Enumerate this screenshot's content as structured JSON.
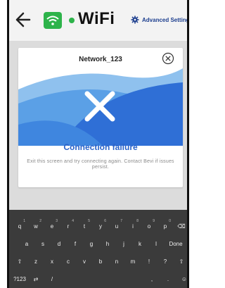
{
  "header": {
    "title": "WiFi",
    "advanced_settings_label": "Advanced Settings"
  },
  "modal": {
    "title": "Network_123",
    "heading": "Connection failure",
    "message": "Exit this screen and try connecting again. Contact Bevi if issues persist."
  },
  "keyboard": {
    "row1": [
      {
        "label": "q",
        "sub": "1"
      },
      {
        "label": "w",
        "sub": "2"
      },
      {
        "label": "e",
        "sub": "3"
      },
      {
        "label": "r",
        "sub": "4"
      },
      {
        "label": "t",
        "sub": "5"
      },
      {
        "label": "y",
        "sub": "6"
      },
      {
        "label": "u",
        "sub": "7"
      },
      {
        "label": "i",
        "sub": "8"
      },
      {
        "label": "o",
        "sub": "9"
      },
      {
        "label": "p",
        "sub": "0"
      },
      {
        "label": "⌫",
        "sub": ""
      }
    ],
    "row2": [
      {
        "label": "a"
      },
      {
        "label": "s"
      },
      {
        "label": "d"
      },
      {
        "label": "f"
      },
      {
        "label": "g"
      },
      {
        "label": "h"
      },
      {
        "label": "j"
      },
      {
        "label": "k"
      },
      {
        "label": "l"
      },
      {
        "label": "Done"
      }
    ],
    "row3": [
      {
        "label": "⇧"
      },
      {
        "label": "z"
      },
      {
        "label": "x"
      },
      {
        "label": "c"
      },
      {
        "label": "v"
      },
      {
        "label": "b"
      },
      {
        "label": "n"
      },
      {
        "label": "m"
      },
      {
        "label": "!"
      },
      {
        "label": "?"
      },
      {
        "label": "⇧"
      }
    ],
    "row4": [
      {
        "label": "?123"
      },
      {
        "label": "⇄"
      },
      {
        "label": "/"
      },
      {
        "label": ""
      },
      {
        "label": ","
      },
      {
        "label": "."
      },
      {
        "label": "☺"
      }
    ]
  },
  "colors": {
    "accent_green": "#2db34a",
    "accent_blue": "#2b63c9",
    "keyboard_bg": "#3b3b3b"
  }
}
